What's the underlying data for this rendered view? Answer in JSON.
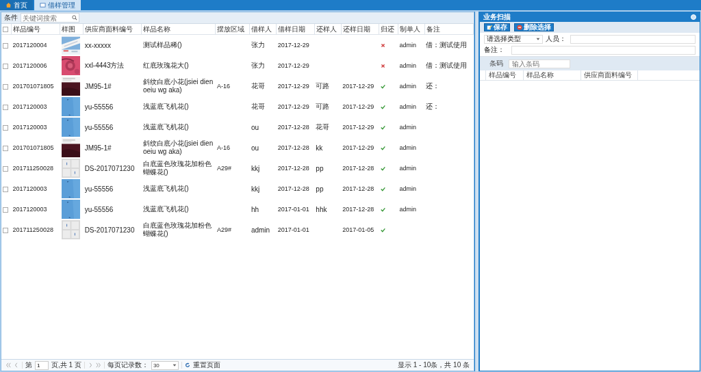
{
  "tabs": [
    {
      "label": "首页",
      "selected": false
    },
    {
      "label": "借样管理",
      "selected": true
    }
  ],
  "search": {
    "label": "条件",
    "placeholder": "关键词搜索"
  },
  "table": {
    "select_all_checked": false,
    "columns": [
      "样品编号",
      "样图",
      "供应商面料编号",
      "样品名称",
      "摆放区域",
      "借样人",
      "借样日期",
      "还样人",
      "还样日期",
      "归还",
      "制单人",
      "备注"
    ],
    "rows": [
      {
        "checked": false,
        "id": "2017120004",
        "supplier_code": "xx-xxxxx",
        "name": "测试样品稀()",
        "area": "",
        "borrower": "张力",
        "borrow_date": "2017-12-29",
        "returner": "",
        "return_date": "",
        "returned": false,
        "creator": "admin",
        "note": "借：测试使用"
      },
      {
        "checked": false,
        "id": "2017120006",
        "supplier_code": "xxl-4443方法",
        "name": "红底玫瑰花大()",
        "area": "",
        "borrower": "张力",
        "borrow_date": "2017-12-29",
        "returner": "",
        "return_date": "",
        "returned": false,
        "creator": "admin",
        "note": "借：测试使用"
      },
      {
        "checked": false,
        "id": "201701071805",
        "supplier_code": "JM95-1#",
        "name": "斜纹白底小花(jsiei dien oeiu wg aka)",
        "area": "A-16",
        "borrower": "花哥",
        "borrow_date": "2017-12-29",
        "returner": "可路",
        "return_date": "2017-12-29",
        "returned": true,
        "creator": "admin",
        "note": "还："
      },
      {
        "checked": false,
        "id": "2017120003",
        "supplier_code": "yu-55556",
        "name": "浅蓝底飞机花()",
        "area": "",
        "borrower": "花哥",
        "borrow_date": "2017-12-29",
        "returner": "可路",
        "return_date": "2017-12-29",
        "returned": true,
        "creator": "admin",
        "note": "还："
      },
      {
        "checked": false,
        "id": "2017120003",
        "supplier_code": "yu-55556",
        "name": "浅蓝底飞机花()",
        "area": "",
        "borrower": "ou",
        "borrow_date": "2017-12-28",
        "returner": "花哥",
        "return_date": "2017-12-29",
        "returned": true,
        "creator": "admin",
        "note": ""
      },
      {
        "checked": false,
        "id": "201701071805",
        "supplier_code": "JM95-1#",
        "name": "斜纹白底小花(jsiei dien oeiu wg aka)",
        "area": "A-16",
        "borrower": "ou",
        "borrow_date": "2017-12-28",
        "returner": "kk",
        "return_date": "2017-12-29",
        "returned": true,
        "creator": "admin",
        "note": ""
      },
      {
        "checked": false,
        "id": "201711250028",
        "supplier_code": "DS-2017071230",
        "name": "白底蓝色玫瑰花加粉色蝴蝶花()",
        "area": "A29#",
        "borrower": "kkj",
        "borrow_date": "2017-12-28",
        "returner": "pp",
        "return_date": "2017-12-28",
        "returned": true,
        "creator": "admin",
        "note": ""
      },
      {
        "checked": false,
        "id": "2017120003",
        "supplier_code": "yu-55556",
        "name": "浅蓝底飞机花()",
        "area": "",
        "borrower": "kkj",
        "borrow_date": "2017-12-28",
        "returner": "pp",
        "return_date": "2017-12-28",
        "returned": true,
        "creator": "admin",
        "note": ""
      },
      {
        "checked": false,
        "id": "2017120003",
        "supplier_code": "yu-55556",
        "name": "浅蓝底飞机花()",
        "area": "",
        "borrower": "hh",
        "borrow_date": "2017-01-01",
        "returner": "hhk",
        "return_date": "2017-12-28",
        "returned": true,
        "creator": "admin",
        "note": ""
      },
      {
        "checked": false,
        "id": "201711250028",
        "supplier_code": "DS-2017071230",
        "name": "白底蓝色玫瑰花加粉色蝴蝶花()",
        "area": "A29#",
        "borrower": "admin",
        "borrow_date": "2017-01-01",
        "returner": "",
        "return_date": "2017-01-05",
        "returned": true,
        "creator": "",
        "note": ""
      }
    ]
  },
  "pager": {
    "page_label": "第",
    "page": "1",
    "page_total": "页,共 1 页",
    "page_size_label": "每页记录数：",
    "page_size": "30",
    "reset": "重置页面",
    "summary": "显示 1 - 10条，共 10 条"
  },
  "scan_panel": {
    "title": "业务扫描",
    "buttons": [
      {
        "label": "保存",
        "kind": "save"
      },
      {
        "label": "删除选择",
        "kind": "delete"
      }
    ],
    "type_select": "请选择类型",
    "person_label": "人员：",
    "note_label": "备注：",
    "barcode_label": "条码",
    "barcode_placeholder": "输入条码",
    "columns": [
      "样品编号",
      "样品名称",
      "供应商面料编号"
    ]
  }
}
